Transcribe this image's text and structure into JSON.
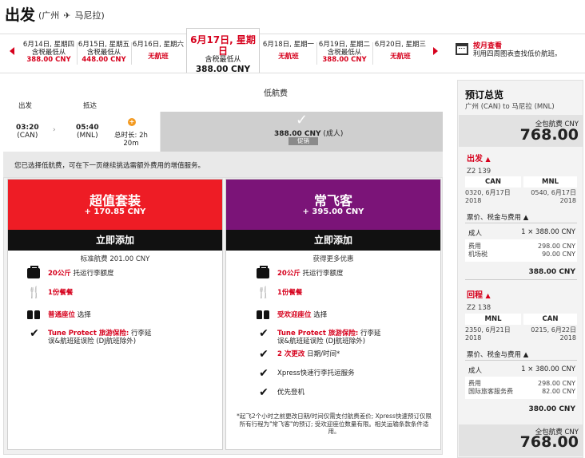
{
  "header": {
    "title": "出发",
    "from": "广州",
    "to": "马尼拉"
  },
  "dates": [
    {
      "d": "6月14日, 星期四",
      "s": "含税最低从",
      "p": "388.00 CNY"
    },
    {
      "d": "6月15日, 星期五",
      "s": "含税最低从",
      "p": "448.00 CNY"
    },
    {
      "d": "6月16日, 星期六",
      "s": "",
      "p": "无航班"
    },
    {
      "d": "6月17日, 星期日",
      "s": "含税最低从",
      "p": "388.00 CNY"
    },
    {
      "d": "6月18日, 星期一",
      "s": "",
      "p": "无航班"
    },
    {
      "d": "6月19日, 星期二",
      "s": "含税最低从",
      "p": "388.00 CNY"
    },
    {
      "d": "6月20日, 星期三",
      "s": "",
      "p": "无航班"
    }
  ],
  "calendar": {
    "link": "按月查看",
    "desc": "利用四周图表查找低价航班。"
  },
  "table": {
    "fare_header": "低航费",
    "col_dep": "出发",
    "col_arr": "抵达",
    "dep_time": "03:20",
    "dep_code": "(CAN)",
    "arr_time": "05:40",
    "arr_code": "(MNL)",
    "stops": "+",
    "dur1": "总时长: 2h",
    "dur2": "20m",
    "check": "✓",
    "sel_price": "388.00 CNY",
    "sel_suffix": " (成人)",
    "promo": "促销",
    "note": "您已选择低航费，可在下一页继续挑选需额外费用的增值服务。"
  },
  "bundles": [
    {
      "name": "超值套装",
      "price": "+ 170.85 CNY",
      "btn": "立即添加",
      "sub": "标准航费 201.00 CNY",
      "feats": [
        {
          "hl": "20公斤",
          "t": " 托运行李额度"
        },
        {
          "hl": "1份餐餐",
          "t": ""
        },
        {
          "hl": "普通座位",
          "t": " 选择"
        },
        {
          "hl": "Tune Protect 旅游保险:",
          "t": " 行李延",
          "t2": "误&航班延误险 (DJ航班除外)"
        }
      ]
    },
    {
      "name": "常飞客",
      "price": "+ 395.00 CNY",
      "btn": "立即添加",
      "sub": "获得更多优惠",
      "feats": [
        {
          "hl": "20公斤",
          "t": " 托运行李额度"
        },
        {
          "hl": "1份餐餐",
          "t": ""
        },
        {
          "hl": "受欢迎座位",
          "t": " 选择"
        },
        {
          "hl": "Tune Protect 旅游保险:",
          "t": " 行李延",
          "t2": "误&航班延误险 (DJ航班除外)"
        },
        {
          "hl": "2 次更改",
          "t": " 日期/时间*"
        },
        {
          "hl": "",
          "t": "Xpress快速行李托运服务"
        },
        {
          "hl": "",
          "t": "优先登机"
        }
      ],
      "fine": "*起飞2个小时之前更改日期/时间仅需支付航费差价; Xpress快速预订仅限所有行程为\"常飞客\"的预订; 受欢迎座位数量有限。相关运输条款条件适用。"
    }
  ],
  "summary": {
    "title": "预订总览",
    "route": "广州 (CAN) to 马尼拉 (MNL)",
    "total_label": "全包航费 CNY",
    "total": "768.00",
    "out": {
      "title": "出发",
      "up": "▲",
      "fno": "Z2 139",
      "from": "CAN",
      "to": "MNL",
      "t1": "0320, 6月17日",
      "y1": "2018",
      "t2": "0540, 6月17日",
      "y2": "2018",
      "tax_h": "票价、税金与费用 ▲",
      "pax": "成人",
      "pax_v": "1 × 388.00 CNY",
      "f1": "费用",
      "f1v": "298.00 CNY",
      "f2": "机场税",
      "f2v": "90.00 CNY",
      "sum": "388.00 CNY"
    },
    "ret": {
      "title": "回程",
      "up": "▲",
      "fno": "Z2 138",
      "from": "MNL",
      "to": "CAN",
      "t1": "2350, 6月21日",
      "y1": "2018",
      "t2": "0215, 6月22日",
      "y2": "2018",
      "tax_h": "票价、税金与费用 ▲",
      "pax": "成人",
      "pax_v": "1 × 380.00 CNY",
      "f1": "费用",
      "f1v": "298.00 CNY",
      "f2": "国际旅客服务费",
      "f2v": "82.00 CNY",
      "sum": "380.00 CNY"
    },
    "total2_label": "全包航费 CNY",
    "total2": "768.00"
  },
  "colors": {
    "red": "#ee1c25",
    "purple": "#7b1478",
    "accent": "#d6001c"
  }
}
